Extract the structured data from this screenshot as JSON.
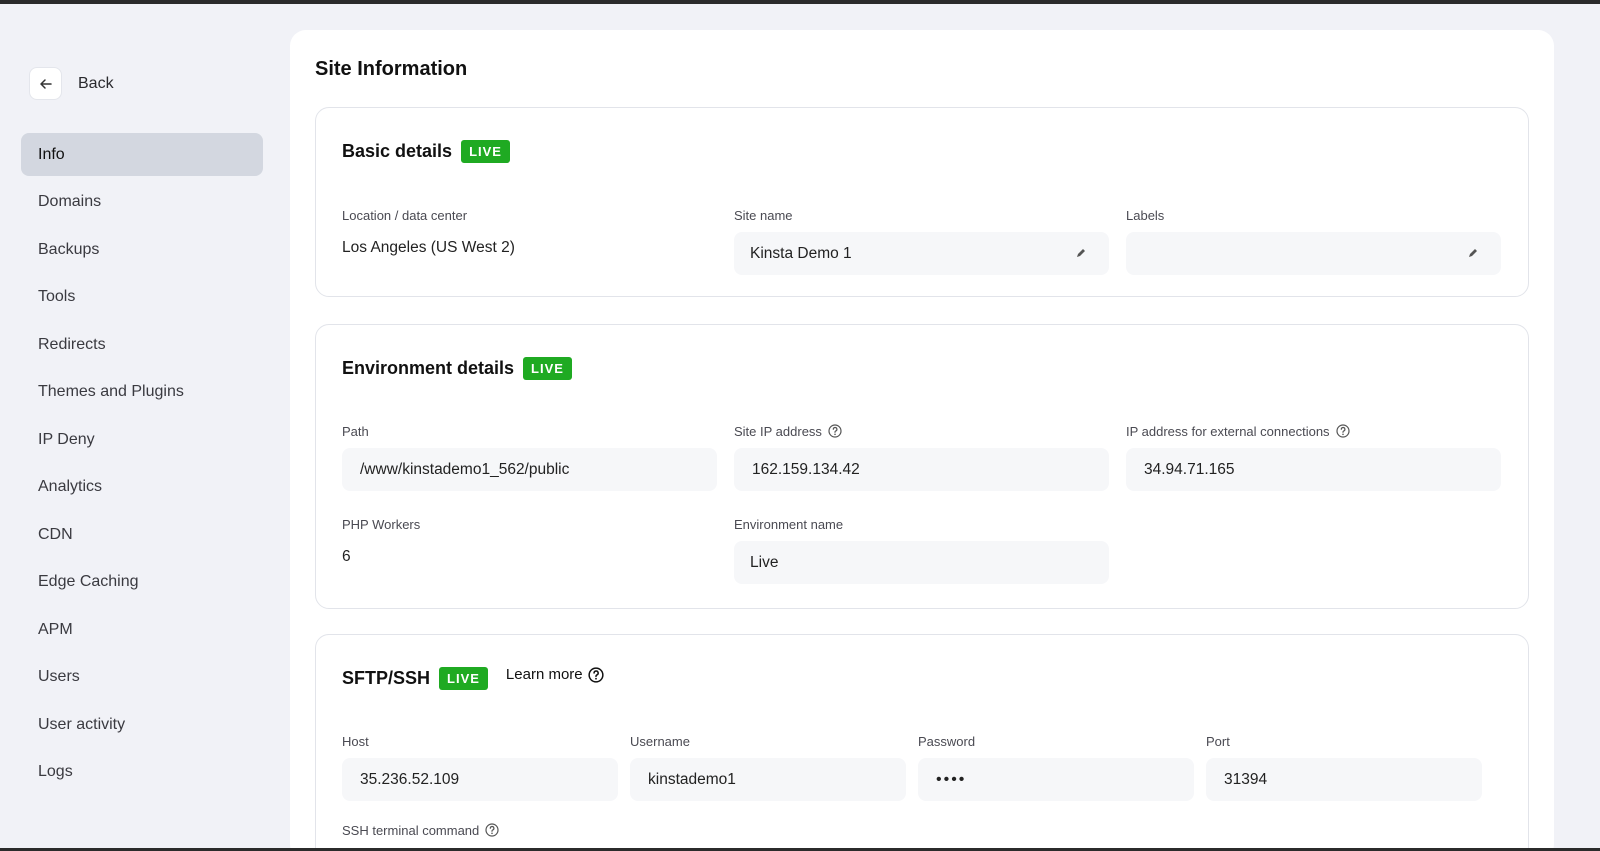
{
  "sidebar": {
    "back_label": "Back",
    "items": [
      {
        "label": "Info",
        "active": true
      },
      {
        "label": "Domains"
      },
      {
        "label": "Backups"
      },
      {
        "label": "Tools"
      },
      {
        "label": "Redirects"
      },
      {
        "label": "Themes and Plugins"
      },
      {
        "label": "IP Deny"
      },
      {
        "label": "Analytics"
      },
      {
        "label": "CDN"
      },
      {
        "label": "Edge Caching"
      },
      {
        "label": "APM"
      },
      {
        "label": "Users"
      },
      {
        "label": "User activity"
      },
      {
        "label": "Logs"
      }
    ]
  },
  "page": {
    "title": "Site Information"
  },
  "basic": {
    "title": "Basic details",
    "badge": "LIVE",
    "location_label": "Location / data center",
    "location_value": "Los Angeles (US West 2)",
    "site_name_label": "Site name",
    "site_name_value": "Kinsta Demo 1",
    "labels_label": "Labels",
    "labels_value": ""
  },
  "environment": {
    "title": "Environment details",
    "badge": "LIVE",
    "path_label": "Path",
    "path_value": "/www/kinstademo1_562/public",
    "site_ip_label": "Site IP address",
    "site_ip_value": "162.159.134.42",
    "ext_ip_label": "IP address for external connections",
    "ext_ip_value": "34.94.71.165",
    "php_label": "PHP Workers",
    "php_value": "6",
    "env_name_label": "Environment name",
    "env_name_value": "Live"
  },
  "sftp": {
    "title": "SFTP/SSH",
    "badge": "LIVE",
    "learn_more": "Learn more",
    "host_label": "Host",
    "host_value": "35.236.52.109",
    "username_label": "Username",
    "username_value": "kinstademo1",
    "password_label": "Password",
    "password_value": "••••",
    "port_label": "Port",
    "port_value": "31394",
    "ssh_label": "SSH terminal command"
  },
  "colors": {
    "background": "#f1f2f7",
    "live_badge": "#1faa22",
    "active_nav": "#d3d7e0",
    "field_bg": "#f6f7f9"
  },
  "icons": [
    "arrow-left-icon",
    "pencil-icon",
    "help-circle-icon"
  ]
}
